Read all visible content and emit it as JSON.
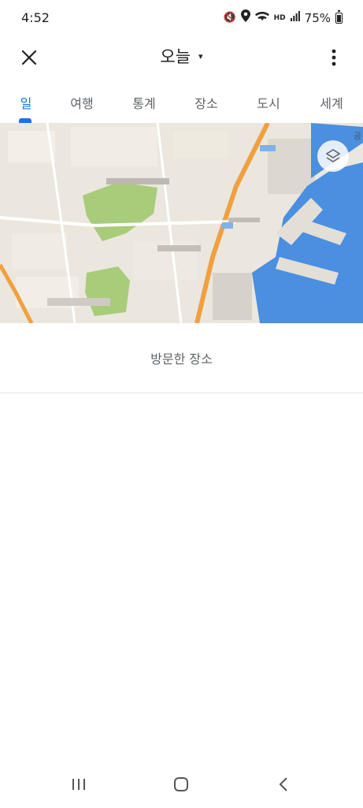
{
  "status_bar": {
    "time": "4:52",
    "battery": "75%",
    "icons": [
      "mute-icon",
      "location-icon",
      "wifi-icon",
      "hd-icon",
      "signal-icon",
      "battery-icon"
    ]
  },
  "app_bar": {
    "title": "오늘",
    "caret": "▾",
    "close_icon": "close-icon",
    "more_icon": "more-vert-icon"
  },
  "tabs": [
    {
      "label": "일",
      "active": true
    },
    {
      "label": "여행",
      "active": false
    },
    {
      "label": "통계",
      "active": false
    },
    {
      "label": "장소",
      "active": false
    },
    {
      "label": "도시",
      "active": false
    },
    {
      "label": "세계",
      "active": false
    }
  ],
  "map": {
    "label": "공"
  },
  "visited": {
    "label": "방문한 장소"
  },
  "nav_bar": {
    "buttons": [
      "recents-icon",
      "home-icon",
      "back-icon"
    ]
  },
  "colors": {
    "accent": "#1a73e8",
    "water": "#4a8fe0",
    "park": "#a8cc7a",
    "road": "#f0a040"
  }
}
